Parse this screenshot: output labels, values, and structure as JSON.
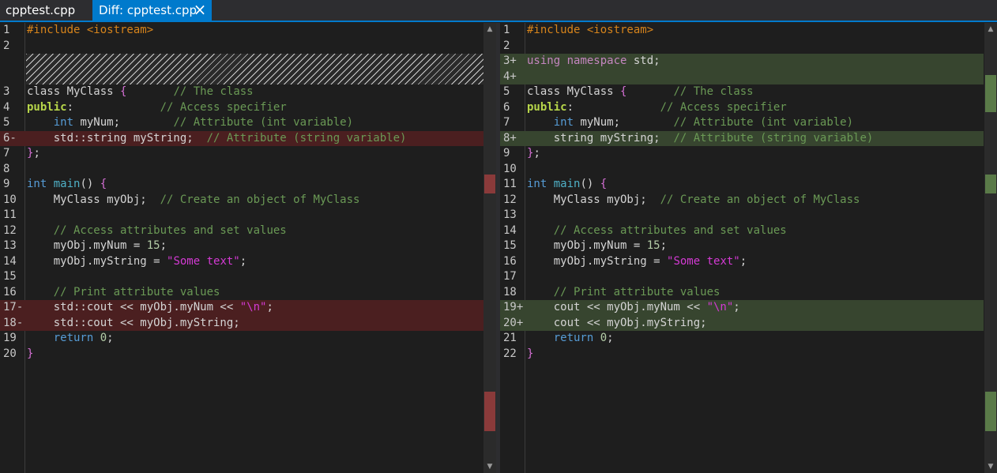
{
  "tabs": [
    {
      "label": "cpptest.cpp",
      "active": false
    },
    {
      "label": "Diff: cpptest.cpp",
      "active": true,
      "close": "×"
    }
  ],
  "colors": {
    "accent": "#007acc",
    "deleted_bg": "#4b1f20",
    "added_bg": "#37452f",
    "editor_bg": "#1e1e1e"
  },
  "left": {
    "lines": [
      {
        "n": "1",
        "kind": "ctx",
        "text": "#include <iostream>"
      },
      {
        "n": "2",
        "kind": "ctx",
        "text": ""
      },
      {
        "n": "3",
        "kind": "ctx",
        "text": "class MyClass {       // The class"
      },
      {
        "n": "4",
        "kind": "ctx",
        "text": "public:             // Access specifier"
      },
      {
        "n": "5",
        "kind": "ctx",
        "text": "    int myNum;        // Attribute (int variable)"
      },
      {
        "n": "6-",
        "kind": "del",
        "text": "    std::string myString;  // Attribute (string variable)"
      },
      {
        "n": "7",
        "kind": "ctx",
        "text": "};"
      },
      {
        "n": "8",
        "kind": "ctx",
        "text": ""
      },
      {
        "n": "9",
        "kind": "ctx",
        "text": "int main() {"
      },
      {
        "n": "10",
        "kind": "ctx",
        "text": "    MyClass myObj;  // Create an object of MyClass"
      },
      {
        "n": "11",
        "kind": "ctx",
        "text": ""
      },
      {
        "n": "12",
        "kind": "ctx",
        "text": "    // Access attributes and set values"
      },
      {
        "n": "13",
        "kind": "ctx",
        "text": "    myObj.myNum = 15;"
      },
      {
        "n": "14",
        "kind": "ctx",
        "text": "    myObj.myString = \"Some text\";"
      },
      {
        "n": "15",
        "kind": "ctx",
        "text": ""
      },
      {
        "n": "16",
        "kind": "ctx",
        "text": "    // Print attribute values"
      },
      {
        "n": "17-",
        "kind": "del",
        "text": "    std::cout << myObj.myNum << \"\\n\";"
      },
      {
        "n": "18-",
        "kind": "del",
        "text": "    std::cout << myObj.myString;"
      },
      {
        "n": "19",
        "kind": "ctx",
        "text": "    return 0;"
      },
      {
        "n": "20",
        "kind": "ctx",
        "text": "}"
      }
    ]
  },
  "right": {
    "lines": [
      {
        "n": "1",
        "kind": "ctx",
        "text": "#include <iostream>"
      },
      {
        "n": "2",
        "kind": "ctx",
        "text": ""
      },
      {
        "n": "3+",
        "kind": "add",
        "text": "using namespace std;"
      },
      {
        "n": "4+",
        "kind": "add",
        "text": ""
      },
      {
        "n": "5",
        "kind": "ctx",
        "text": "class MyClass {       // The class"
      },
      {
        "n": "6",
        "kind": "ctx",
        "text": "public:             // Access specifier"
      },
      {
        "n": "7",
        "kind": "ctx",
        "text": "    int myNum;        // Attribute (int variable)"
      },
      {
        "n": "8+",
        "kind": "add",
        "text": "    string myString;  // Attribute (string variable)"
      },
      {
        "n": "9",
        "kind": "ctx",
        "text": "};"
      },
      {
        "n": "10",
        "kind": "ctx",
        "text": ""
      },
      {
        "n": "11",
        "kind": "ctx",
        "text": "int main() {"
      },
      {
        "n": "12",
        "kind": "ctx",
        "text": "    MyClass myObj;  // Create an object of MyClass"
      },
      {
        "n": "13",
        "kind": "ctx",
        "text": ""
      },
      {
        "n": "14",
        "kind": "ctx",
        "text": "    // Access attributes and set values"
      },
      {
        "n": "15",
        "kind": "ctx",
        "text": "    myObj.myNum = 15;"
      },
      {
        "n": "16",
        "kind": "ctx",
        "text": "    myObj.myString = \"Some text\";"
      },
      {
        "n": "17",
        "kind": "ctx",
        "text": ""
      },
      {
        "n": "18",
        "kind": "ctx",
        "text": "    // Print attribute values"
      },
      {
        "n": "19+",
        "kind": "add",
        "text": "    cout << myObj.myNum << \"\\n\";"
      },
      {
        "n": "20+",
        "kind": "add",
        "text": "    cout << myObj.myString;"
      },
      {
        "n": "21",
        "kind": "ctx",
        "text": "    return 0;"
      },
      {
        "n": "22",
        "kind": "ctx",
        "text": "}"
      }
    ]
  }
}
